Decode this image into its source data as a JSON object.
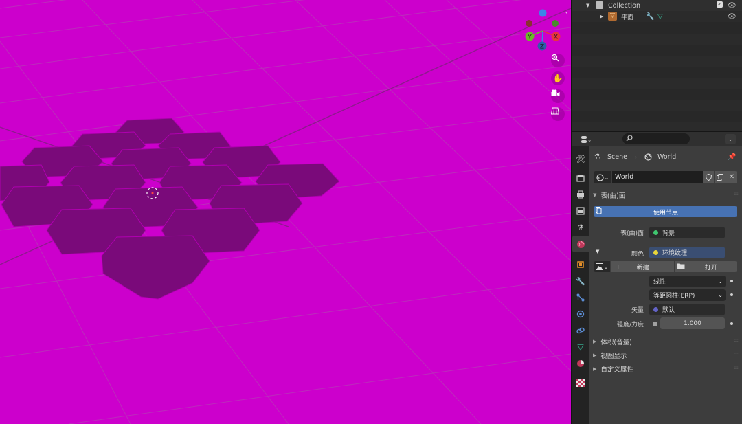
{
  "outliner": {
    "collection_label": "Collection",
    "object_label": "平面"
  },
  "properties_header": {
    "search_placeholder": ""
  },
  "breadcrumb": {
    "scene": "Scene",
    "world": "World"
  },
  "world_selector": {
    "name": "World"
  },
  "surface_panel": {
    "title": "表(曲)面",
    "use_nodes_label": "使用节点",
    "surface_label": "表(曲)面",
    "surface_value": "背景",
    "color_label": "颜色",
    "color_value": "环境纹理",
    "new_label": "新建",
    "open_label": "打开",
    "interpolation_value": "线性",
    "projection_value": "等距圆柱(ERP)",
    "vector_label": "矢量",
    "vector_value": "默认",
    "strength_label": "强度/力度",
    "strength_value": "1.000"
  },
  "collapsed_panels": [
    "体积(音量)",
    "视图显示",
    "自定义属性"
  ],
  "gizmo": {
    "x_label": "X",
    "y_label": "Y",
    "z_label": "Z"
  },
  "colors": {
    "viewport_bg": "#cc00cc",
    "tile": "#7a0a7a",
    "accent_blue": "#4772b3",
    "x_axis": "#e8343f",
    "y_axis": "#6bb82a",
    "z_axis": "#3d84e8"
  }
}
